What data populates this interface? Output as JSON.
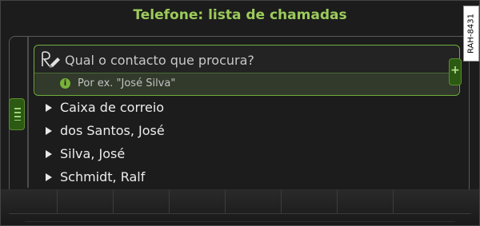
{
  "screen": {
    "title": "Telefone: lista de chamadas"
  },
  "search": {
    "placeholder": "Qual o contacto que procura?",
    "hint": "Por ex. \"José Silva\"",
    "hint_icon": "info-icon",
    "input_icon": "handwriting-input-icon"
  },
  "contacts": {
    "items": [
      {
        "label": "Caixa de correio"
      },
      {
        "label": "dos Santos, José"
      },
      {
        "label": "Silva, José"
      },
      {
        "label": "Schmidt, Ralf"
      }
    ]
  },
  "controls": {
    "add_symbol": "+"
  },
  "figure": {
    "reference_code": "RAH-8431"
  },
  "colors": {
    "accent_green": "#9ccb5b",
    "background": "#1c1c1c"
  }
}
